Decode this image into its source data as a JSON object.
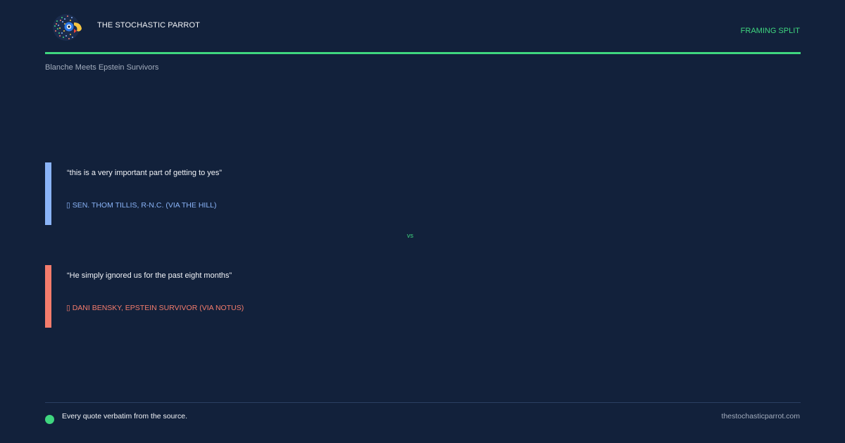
{
  "header": {
    "brand": "THE STOCHASTIC PARROT",
    "label": "FRAMING SPLIT",
    "subtitle": "Blanche Meets Epstein Survivors",
    "logo_icon": "parrot-logo-icon"
  },
  "quotes": [
    {
      "text": "“this is a very important part of getting to yes”",
      "attribution": "▯ SEN. THOM TILLIS, R-N.C. (VIA THE HILL)",
      "color": "#8ab4f8"
    },
    {
      "text": "“He simply ignored us for the past eight months”",
      "attribution": "▯ DANI BENSKY, EPSTEIN SURVIVOR (VIA NOTUS)",
      "color": "#f47c6c"
    }
  ],
  "divider_label": "vs",
  "footer": {
    "note": "Every quote verbatim from the source.",
    "url": "thestochasticparrot.com"
  },
  "colors": {
    "background": "#12213b",
    "accent": "#3fd67f",
    "quote_blue": "#8ab4f8",
    "quote_red": "#f47c6c"
  }
}
